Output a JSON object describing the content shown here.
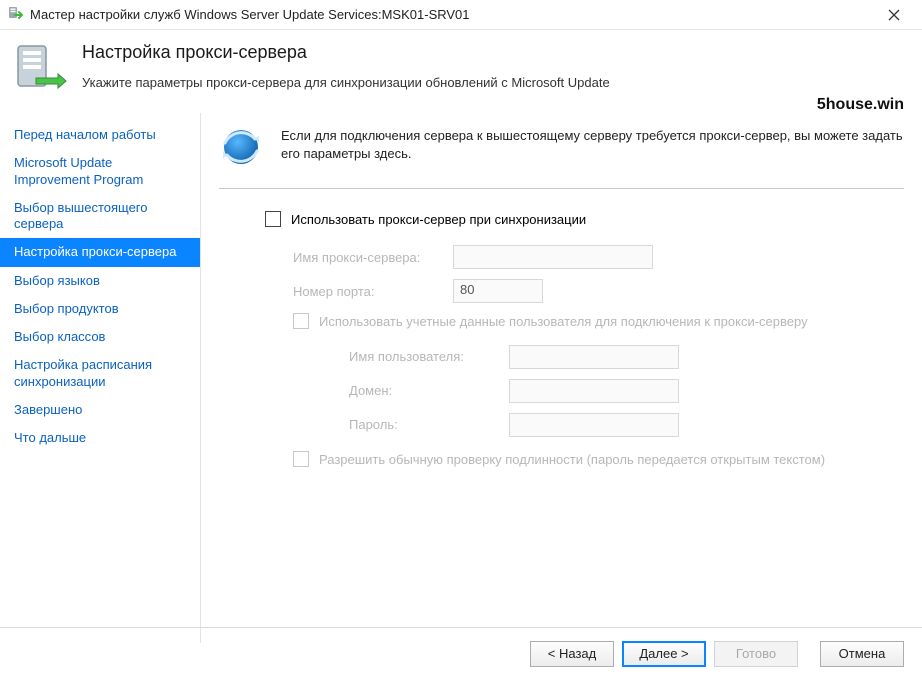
{
  "window": {
    "title": "Мастер настройки служб Windows Server Update Services:MSK01-SRV01"
  },
  "header": {
    "title": "Настройка прокси-сервера",
    "subtitle": "Укажите параметры прокси-сервера для синхронизации обновлений с Microsoft Update"
  },
  "watermark": "5house.win",
  "sidebar": {
    "items": [
      "Перед началом работы",
      "Microsoft Update Improvement Program",
      "Выбор вышестоящего сервера",
      "Настройка прокси-сервера",
      "Выбор языков",
      "Выбор продуктов",
      "Выбор классов",
      "Настройка расписания синхронизации",
      "Завершено",
      "Что дальше"
    ],
    "selected_index": 3
  },
  "main": {
    "intro": "Если для подключения сервера к вышестоящему серверу требуется прокси-сервер, вы можете задать его параметры здесь.",
    "use_proxy_label": "Использовать прокси-сервер при синхронизации",
    "proxy_name_label": "Имя прокси-сервера:",
    "port_label": "Номер порта:",
    "port_value": "80",
    "use_credentials_label": "Использовать учетные данные пользователя для подключения к прокси-серверу",
    "username_label": "Имя пользователя:",
    "domain_label": "Домен:",
    "password_label": "Пароль:",
    "basic_auth_label": "Разрешить обычную проверку подлинности (пароль передается открытым текстом)"
  },
  "footer": {
    "back": "< Назад",
    "next": "Далее >",
    "finish": "Готово",
    "cancel": "Отмена"
  }
}
